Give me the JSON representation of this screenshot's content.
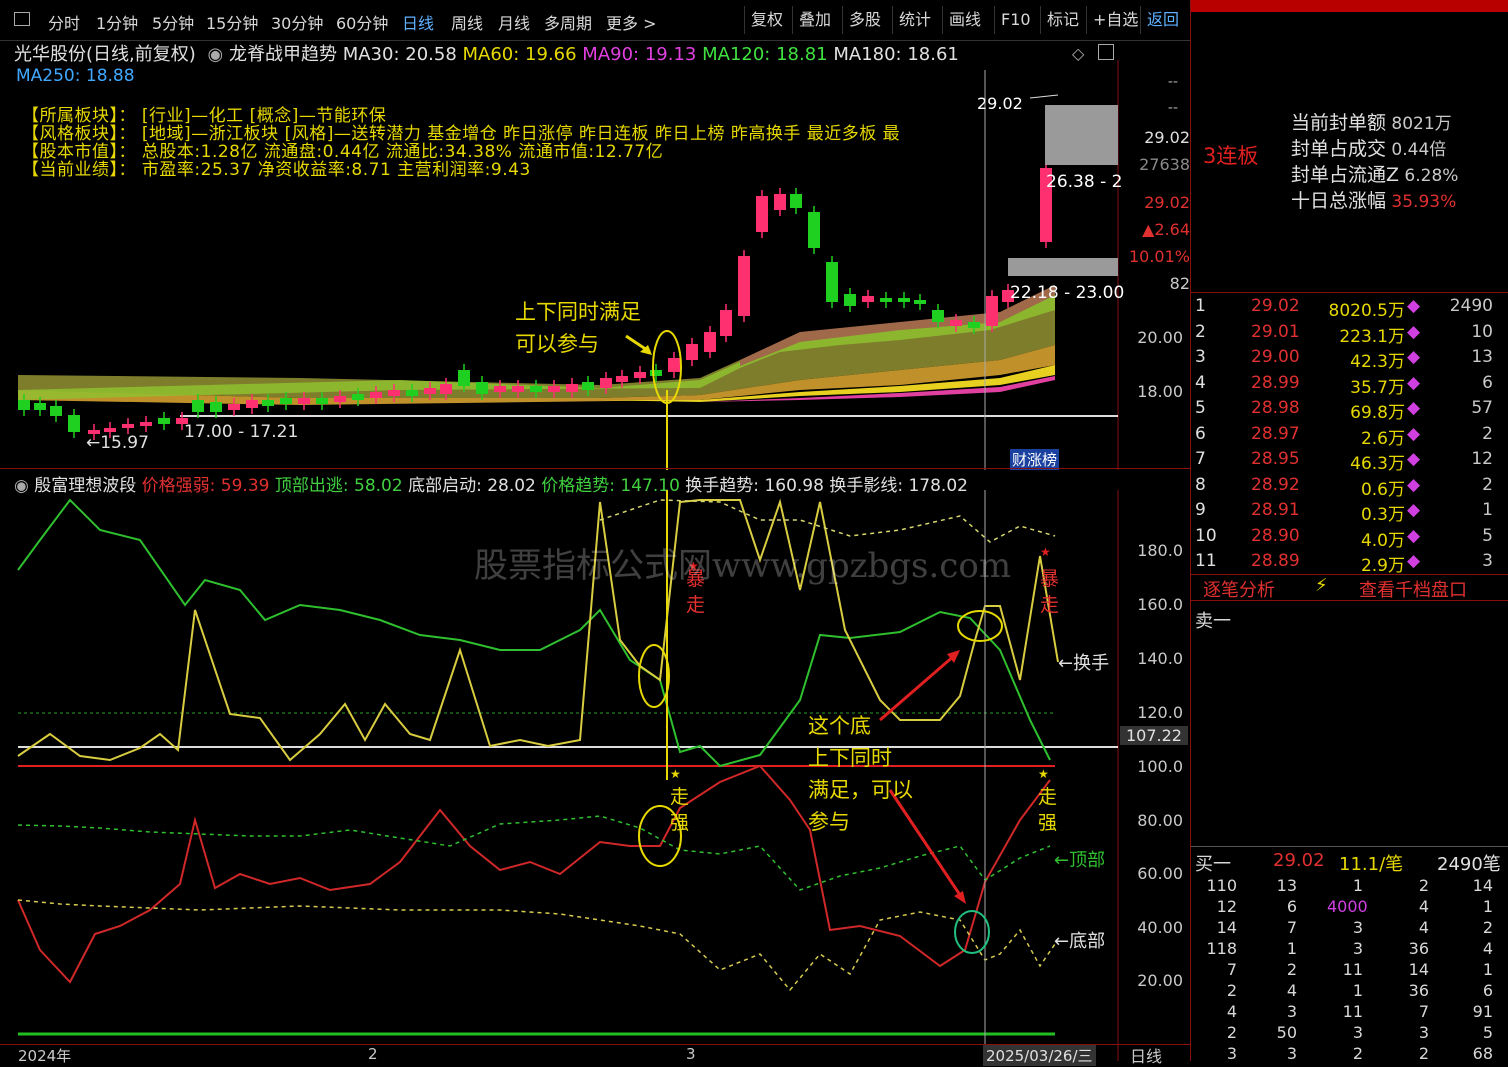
{
  "toolbar": {
    "periods": [
      "分时",
      "1分钟",
      "5分钟",
      "15分钟",
      "30分钟",
      "60分钟",
      "日线",
      "周线",
      "月线",
      "多周期",
      "更多 >"
    ],
    "active": "日线",
    "buttons": [
      "复权",
      "叠加",
      "多股",
      "统计",
      "画线",
      "F10",
      "标记",
      "+自选",
      "返回"
    ]
  },
  "chart_title": {
    "stock": "光华股份(日线,前复权)",
    "indicator": "龙脊战甲趋势",
    "ma": [
      {
        "label": "MA30: 20.58",
        "color": "#e0e0e0"
      },
      {
        "label": "MA60: 19.66",
        "color": "#e6d800"
      },
      {
        "label": "MA90: 19.13",
        "color": "#e040e0"
      },
      {
        "label": "MA120: 18.81",
        "color": "#40e040"
      },
      {
        "label": "MA180: 18.61",
        "color": "#e0e0e0"
      }
    ],
    "ma250": "MA250: 18.88"
  },
  "info_rows": [
    "【所属板块】： [行业]—化工 [概念]—节能环保",
    "【风格板块】： [地域]—浙江板块 [风格]—送转潜力 基金增仓 昨日涨停 昨日连板 昨日上榜 昨高换手 最近多板 最",
    "【股本市值】： 总股本:1.28亿 流通盘:0.44亿 流通比:34.38% 流通市值:12.77亿",
    "【当前业绩】： 市盈率:25.37 净资收益率:8.71 主营利润率:9.43"
  ],
  "price_labels": {
    "low": "←15.97",
    "range1": "17.00 - 17.21",
    "range2": "22.18 - 23.00",
    "range3": "26.38 - 2",
    "high": "29.02"
  },
  "price_axis": [
    "29.02",
    "27638",
    "29.02",
    "▲2.64",
    "10.01%",
    "82",
    "20.00",
    "18.00"
  ],
  "price_axis_top": [
    "--",
    "--"
  ],
  "caizhangbang": "财涨榜",
  "annotations": {
    "a1": [
      "上下同时满足",
      "可以参与"
    ],
    "a2": [
      "这个底",
      "上下同时",
      "满足，可以",
      "参与"
    ],
    "bao1": [
      "暴",
      "走"
    ],
    "bao2": [
      "暴",
      "走"
    ],
    "zou1": [
      "走",
      "强"
    ],
    "zou2": [
      "走",
      "强"
    ]
  },
  "indicator_title": {
    "name": "殷富理想波段",
    "items": [
      {
        "label": "价格强弱: 59.39",
        "color": "#e03030"
      },
      {
        "label": "顶部出逃: 58.02",
        "color": "#40d040"
      },
      {
        "label": "底部启动: 28.02",
        "color": "#e0e0e0"
      },
      {
        "label": "价格趋势: 147.10",
        "color": "#40d040"
      },
      {
        "label": "换手趋势: 160.98",
        "color": "#e0e0e0"
      },
      {
        "label": "换手影线: 178.02",
        "color": "#e0e0e0"
      }
    ]
  },
  "line_labels": {
    "huanshou": "←换手",
    "dingbu": "←顶部",
    "dibu": "←底部"
  },
  "ind_axis": [
    "180.0",
    "160.0",
    "140.0",
    "120.0",
    "107.22",
    "100.0",
    "80.00",
    "60.00",
    "40.00",
    "20.00"
  ],
  "watermark": "股票指标公式网www.gpzbgs.com",
  "x_axis": {
    "start": "2024年",
    "m2": "2",
    "m3": "3",
    "cursor": "2025/03/26/三",
    "period": "日线"
  },
  "right": {
    "lianban": "3连板",
    "stats": [
      {
        "label": "当前封单额",
        "value": "8021万"
      },
      {
        "label": "封单占成交",
        "value": "0.44倍"
      },
      {
        "label": "封单占流通Z",
        "value": "6.28%"
      },
      {
        "label": "十日总涨幅",
        "value": "35.93%"
      }
    ],
    "orderbook": [
      {
        "n": "1",
        "price": "29.02",
        "vol": "8020.5万",
        "cnt": "2490"
      },
      {
        "n": "2",
        "price": "29.01",
        "vol": "223.1万",
        "cnt": "10"
      },
      {
        "n": "3",
        "price": "29.00",
        "vol": "42.3万",
        "cnt": "13"
      },
      {
        "n": "4",
        "price": "28.99",
        "vol": "35.7万",
        "cnt": "6"
      },
      {
        "n": "5",
        "price": "28.98",
        "vol": "69.8万",
        "cnt": "57"
      },
      {
        "n": "6",
        "price": "28.97",
        "vol": "2.6万",
        "cnt": "2"
      },
      {
        "n": "7",
        "price": "28.95",
        "vol": "46.3万",
        "cnt": "12"
      },
      {
        "n": "8",
        "price": "28.92",
        "vol": "0.6万",
        "cnt": "2"
      },
      {
        "n": "9",
        "price": "28.91",
        "vol": "0.3万",
        "cnt": "1"
      },
      {
        "n": "10",
        "price": "28.90",
        "vol": "4.0万",
        "cnt": "5"
      },
      {
        "n": "11",
        "price": "28.89",
        "vol": "2.9万",
        "cnt": "3"
      }
    ],
    "tab_zhubi": "逐笔分析",
    "tab_qiandang": "查看千档盘口",
    "sell_one": "卖一",
    "buy_one": {
      "label": "买一",
      "price": "29.02",
      "per": "11.1/笔",
      "cnt": "2490笔"
    },
    "buy_table": [
      [
        "110",
        "13",
        "1",
        "2",
        "14"
      ],
      [
        "12",
        "6",
        "4000",
        "4",
        "1"
      ],
      [
        "14",
        "7",
        "3",
        "4",
        "2"
      ],
      [
        "118",
        "1",
        "3",
        "36",
        "4"
      ],
      [
        "7",
        "2",
        "11",
        "14",
        "1"
      ],
      [
        "2",
        "4",
        "1",
        "36",
        "6"
      ],
      [
        "4",
        "3",
        "11",
        "7",
        "91"
      ],
      [
        "2",
        "50",
        "3",
        "3",
        "5"
      ],
      [
        "3",
        "3",
        "2",
        "2",
        "68"
      ]
    ]
  }
}
